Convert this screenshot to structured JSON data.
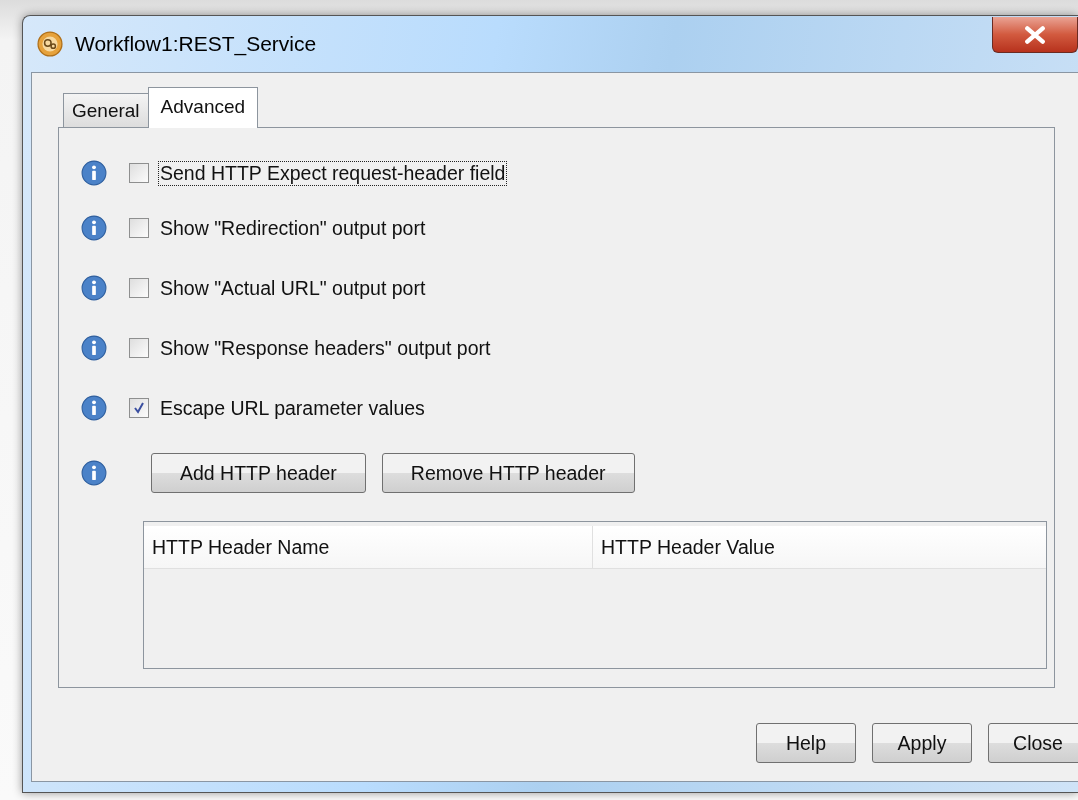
{
  "window": {
    "title": "Workflow1:REST_Service"
  },
  "tabs": [
    {
      "label": "General",
      "selected": false
    },
    {
      "label": "Advanced",
      "selected": true
    }
  ],
  "options": [
    {
      "label": "Send HTTP Expect request-header field",
      "checked": false,
      "focused": true
    },
    {
      "label": "Show \"Redirection\" output port",
      "checked": false,
      "focused": false
    },
    {
      "label": "Show \"Actual URL\" output port",
      "checked": false,
      "focused": false
    },
    {
      "label": "Show \"Response headers\" output port",
      "checked": false,
      "focused": false
    },
    {
      "label": "Escape URL parameter values",
      "checked": true,
      "focused": false
    }
  ],
  "header_buttons": [
    "Add HTTP header",
    "Remove HTTP header"
  ],
  "table": {
    "columns": [
      "HTTP Header Name",
      "HTTP Header Value"
    ]
  },
  "buttons": [
    "Help",
    "Apply",
    "Close"
  ]
}
